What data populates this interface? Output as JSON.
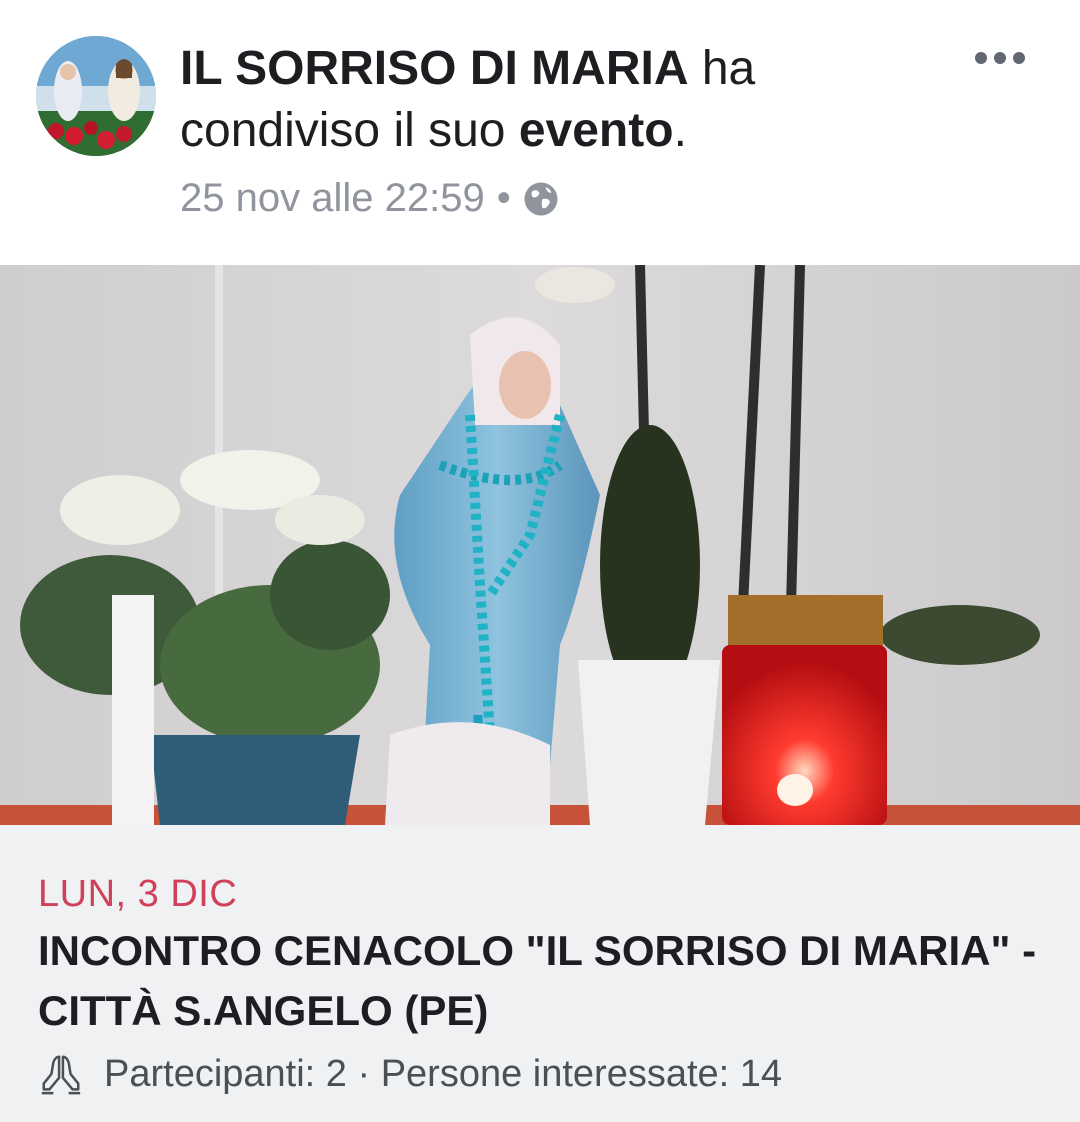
{
  "post": {
    "page_name": "IL SORRISO DI MARIA",
    "action_prefix": " ha",
    "action_line2_prefix": "condiviso il suo ",
    "action_bold": "evento",
    "action_suffix": ".",
    "timestamp": "25 nov alle 22:59",
    "separator": "•",
    "privacy_icon": "globe-icon",
    "more_icon": "more-dots-icon"
  },
  "event": {
    "date": "LUN, 3 DIC",
    "title": "INCONTRO CENACOLO \"IL SORRISO DI MARIA\" - CITTÀ S.ANGELO (PE)",
    "stats_icon": "praying-hands-icon",
    "stats": "Partecipanti: 2 · Persone interessate: 14"
  },
  "colors": {
    "date_accent": "#d0405a",
    "meta_text": "#90949c",
    "info_background": "#f0f1f3"
  }
}
